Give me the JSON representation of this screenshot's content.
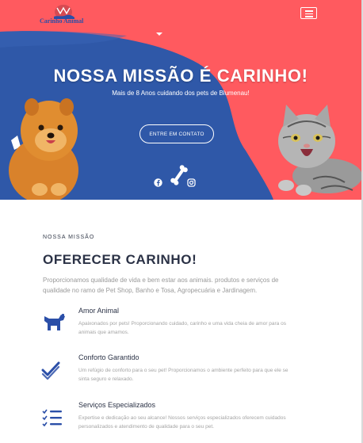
{
  "header": {
    "logo_text": "Carinho Animal",
    "menu_icon": "hamburger-menu-icon"
  },
  "hero": {
    "title": "NOSSA MISSÃO É CARINHO!",
    "subtitle": "Mais de 8 Anos cuidando dos pets de Blumenau!",
    "cta_label": "ENTRE EM CONTATO",
    "social_icons": [
      "facebook-icon",
      "bone-icon",
      "instagram-icon"
    ]
  },
  "mission": {
    "eyebrow": "NOSSA MISSÃO",
    "title": "OFERECER CARINHO!",
    "text": "Proporcionamos qualidade de vida e bem estar aos animais. produtos e serviços de qualidade no ramo de Pet Shop, Banho e Tosa, Agropecuária e Jardinagem.",
    "features": [
      {
        "icon": "dog-icon",
        "title": "Amor Animal",
        "text": "Apaixonados por pets! Proporcionando cuidado, carinho e uma vida cheia de amor para os animais que amamos."
      },
      {
        "icon": "checkmark-icon",
        "title": "Conforto Garantido",
        "text": "Um refúgio de conforto para o seu pet! Proporcionamos o ambiente perfeito para que ele se sinta seguro e relaxado."
      },
      {
        "icon": "checklist-icon",
        "title": "Serviços Especializados",
        "text": "Expertise e dedicação ao seu alcance! Nossos serviços especializados oferecem cuidados personalizados e atendimento de qualidade para o seu pet."
      }
    ]
  },
  "colors": {
    "accent_red": "#ff5a5f",
    "brand_blue": "#2b4fa8",
    "heading_dark": "#2b3246"
  }
}
